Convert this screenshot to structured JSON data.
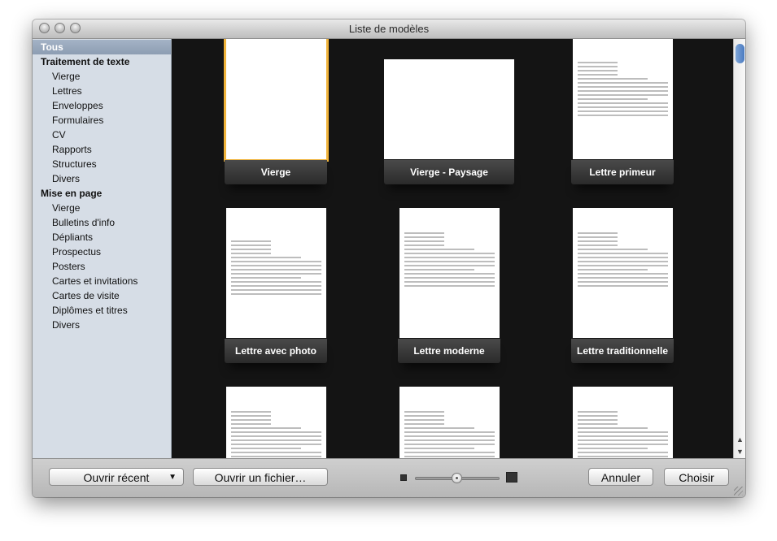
{
  "window": {
    "title": "Liste de modèles"
  },
  "sidebar": {
    "items": [
      {
        "label": "Tous",
        "level": "cat",
        "selected": true
      },
      {
        "label": "Traitement de texte",
        "level": "cat"
      },
      {
        "label": "Vierge",
        "level": "sub"
      },
      {
        "label": "Lettres",
        "level": "sub"
      },
      {
        "label": "Enveloppes",
        "level": "sub"
      },
      {
        "label": "Formulaires",
        "level": "sub"
      },
      {
        "label": "CV",
        "level": "sub"
      },
      {
        "label": "Rapports",
        "level": "sub"
      },
      {
        "label": "Structures",
        "level": "sub"
      },
      {
        "label": "Divers",
        "level": "sub"
      },
      {
        "label": "Mise en page",
        "level": "cat"
      },
      {
        "label": "Vierge",
        "level": "sub"
      },
      {
        "label": "Bulletins d'info",
        "level": "sub"
      },
      {
        "label": "Dépliants",
        "level": "sub"
      },
      {
        "label": "Prospectus",
        "level": "sub"
      },
      {
        "label": "Posters",
        "level": "sub"
      },
      {
        "label": "Cartes et invitations",
        "level": "sub"
      },
      {
        "label": "Cartes de visite",
        "level": "sub"
      },
      {
        "label": "Diplômes et titres",
        "level": "sub"
      },
      {
        "label": "Divers",
        "level": "sub"
      }
    ]
  },
  "templates": [
    {
      "label": "Vierge",
      "selected": true
    },
    {
      "label": "Vierge - Paysage"
    },
    {
      "label": "Lettre primeur"
    },
    {
      "label": "Lettre avec photo"
    },
    {
      "label": "Lettre moderne"
    },
    {
      "label": "Lettre traditionnelle"
    },
    {
      "label": ""
    },
    {
      "label": ""
    },
    {
      "label": ""
    }
  ],
  "toolbar": {
    "open_recent": "Ouvrir récent",
    "open_file": "Ouvrir un fichier…",
    "cancel": "Annuler",
    "choose": "Choisir",
    "zoom_level": 0.5
  },
  "colors": {
    "selection_outline": "#f0b33a",
    "sidebar_bg": "#d6dde6",
    "content_bg": "#141414"
  }
}
